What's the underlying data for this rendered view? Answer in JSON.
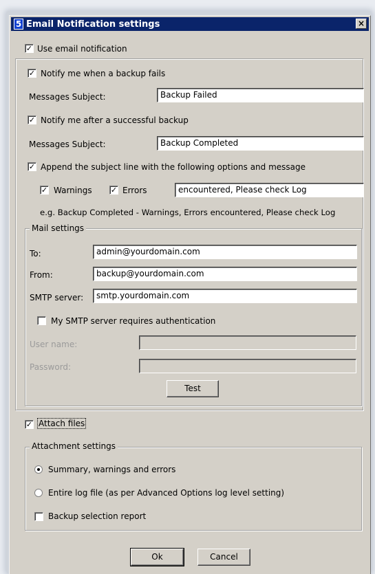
{
  "window": {
    "title": "Email Notification settings",
    "icon_label": "5",
    "close_glyph": "×"
  },
  "use_email": {
    "label": "Use email notification",
    "checked": true
  },
  "notify_fail": {
    "label": "Notify me when a backup fails",
    "checked": true,
    "subject_label": "Messages Subject:",
    "subject_value": "Backup Failed"
  },
  "notify_success": {
    "label": "Notify me after a successful backup",
    "checked": true,
    "subject_label": "Messages Subject:",
    "subject_value": "Backup Completed"
  },
  "append": {
    "label": "Append the subject line with the following options and message",
    "checked": true,
    "warnings_label": "Warnings",
    "warnings_checked": true,
    "errors_label": "Errors",
    "errors_checked": true,
    "message_value": "encountered, Please check Log",
    "example": "e.g. Backup Completed - Warnings, Errors encountered, Please check Log"
  },
  "mail": {
    "legend": "Mail settings",
    "to_label": "To:",
    "to_value": "admin@yourdomain.com",
    "from_label": "From:",
    "from_value": "backup@yourdomain.com",
    "smtp_label": "SMTP server:",
    "smtp_value": "smtp.yourdomain.com",
    "auth_label": "My SMTP server requires authentication",
    "auth_checked": false,
    "user_label": "User name:",
    "user_value": "",
    "password_label": "Password:",
    "password_value": "",
    "test_label": "Test"
  },
  "attach": {
    "label": "Attach files",
    "checked": true
  },
  "attachment": {
    "legend": "Attachment settings",
    "option1": "Summary, warnings and errors",
    "option2": "Entire log file (as per Advanced Options log level setting)",
    "selected": "option1",
    "report_label": "Backup selection report",
    "report_checked": false
  },
  "footer": {
    "ok_label": "Ok",
    "cancel_label": "Cancel"
  },
  "check_glyph": "✓"
}
